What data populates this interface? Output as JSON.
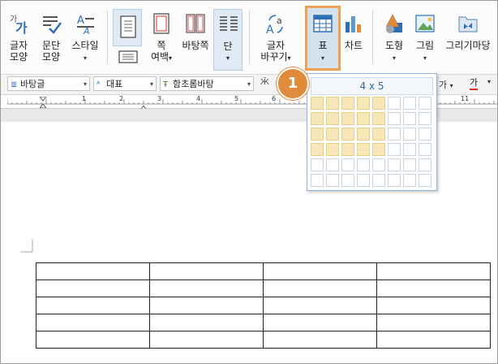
{
  "ribbon": {
    "items": [
      {
        "label_l1": "글자",
        "label_l2": "모양",
        "icon": "char-shape-icon",
        "arrow": ""
      },
      {
        "label_l1": "문단",
        "label_l2": "모양",
        "icon": "para-shape-icon",
        "arrow": ""
      },
      {
        "label_l1": "스타일",
        "label_l2": "",
        "icon": "style-icon",
        "arrow": "▾"
      },
      {
        "label_l1": "",
        "label_l2": "",
        "icon": "page-portrait-icon",
        "arrow": ""
      },
      {
        "label_l1": "쪽",
        "label_l2": "여백",
        "icon": "margin-icon",
        "arrow": "▾"
      },
      {
        "label_l1": "바탕쪽",
        "label_l2": "",
        "icon": "master-page-icon",
        "arrow": ""
      },
      {
        "label_l1": "단",
        "label_l2": "",
        "icon": "columns-icon",
        "arrow": "▾"
      },
      {
        "label_l1": "글자",
        "label_l2": "바꾸기",
        "icon": "change-char-icon",
        "arrow": "▾"
      },
      {
        "label_l1": "표",
        "label_l2": "",
        "icon": "table-icon",
        "arrow": "▾"
      },
      {
        "label_l1": "차트",
        "label_l2": "",
        "icon": "chart-icon",
        "arrow": ""
      },
      {
        "label_l1": "도형",
        "label_l2": "",
        "icon": "shape-icon",
        "arrow": "▾"
      },
      {
        "label_l1": "그림",
        "label_l2": "",
        "icon": "picture-icon",
        "arrow": "▾"
      },
      {
        "label_l1": "그리기마당",
        "label_l2": "",
        "icon": "drawing-gallery-icon",
        "arrow": ""
      }
    ]
  },
  "format_bar": {
    "style": "바탕글",
    "lang": "대표",
    "font": "함초롬바탕",
    "right_a": "가",
    "right_b": "가"
  },
  "ruler": {
    "numbers": [
      "1",
      "2",
      "3",
      "4",
      "5",
      "6",
      "11"
    ]
  },
  "table_picker": {
    "title": "4 x 5",
    "rows": 6,
    "cols": 8,
    "selected_rows": 4,
    "selected_cols": 5
  },
  "callout": {
    "number": "1"
  },
  "doc_table": {
    "rows": 5,
    "cols": 4
  },
  "colors": {
    "accent": "#e08a3c",
    "selected_cell": "#f6e6b8",
    "ribbon_selected": "#dfeaf5"
  }
}
